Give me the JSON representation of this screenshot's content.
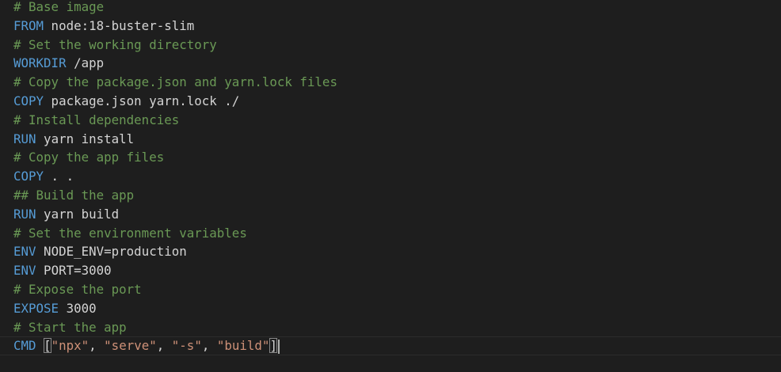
{
  "colors": {
    "background": "#1e1e1e",
    "comment": "#6a9955",
    "keyword": "#569cd6",
    "text": "#d4d4d4",
    "string": "#ce9178"
  },
  "lines": [
    {
      "comment": "# Base image"
    },
    {
      "keyword": "FROM",
      "rest": " node:18-buster-slim"
    },
    {
      "comment": "# Set the working directory"
    },
    {
      "keyword": "WORKDIR",
      "rest": " /app"
    },
    {
      "comment": "# Copy the package.json and yarn.lock files"
    },
    {
      "keyword": "COPY",
      "rest": " package.json yarn.lock ./"
    },
    {
      "comment": "# Install dependencies"
    },
    {
      "keyword": "RUN",
      "rest": " yarn install"
    },
    {
      "comment": "# Copy the app files"
    },
    {
      "keyword": "COPY",
      "rest": " . ."
    },
    {
      "comment": "## Build the app"
    },
    {
      "keyword": "RUN",
      "rest": " yarn build"
    },
    {
      "comment": "# Set the environment variables"
    },
    {
      "keyword": "ENV",
      "rest": " NODE_ENV=production"
    },
    {
      "keyword": "ENV",
      "rest": " PORT=3000"
    },
    {
      "comment": "# Expose the port"
    },
    {
      "keyword": "EXPOSE",
      "rest": " 3000"
    },
    {
      "comment": "# Start the app"
    }
  ],
  "cmd_line": {
    "keyword": "CMD",
    "space": " ",
    "open_bracket": "[",
    "s1": "\"npx\"",
    "sep1": ", ",
    "s2": "\"serve\"",
    "sep2": ", ",
    "s3": "\"-s\"",
    "sep3": ", ",
    "s4": "\"build\"",
    "close_bracket": "]"
  }
}
